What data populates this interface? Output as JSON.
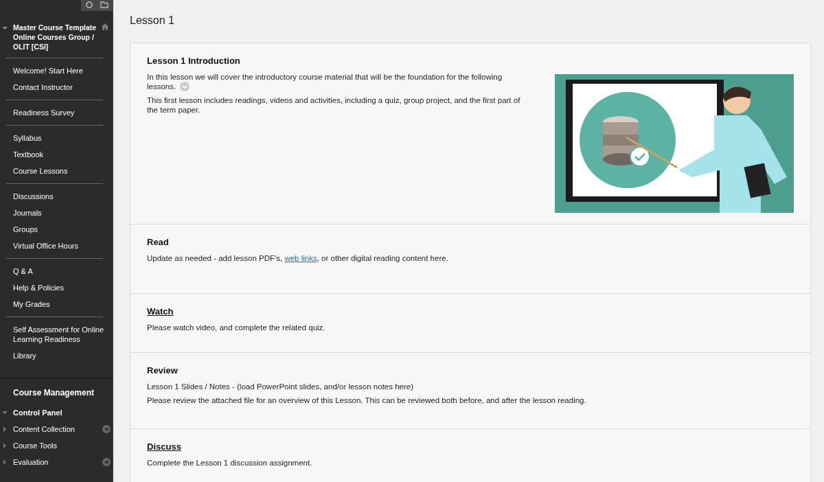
{
  "sidebar": {
    "course": {
      "title": "Master Course Template Online Courses Group / OLIT [CSI]",
      "expanded": true
    },
    "groups": [
      [
        "Welcome! Start Here",
        "Contact Instructor"
      ],
      [
        "Readiness Survey"
      ],
      [
        "Syllabus",
        "Textbook",
        "Course Lessons"
      ],
      [
        "Discussions",
        "Journals",
        "Groups",
        "Virtual Office Hours"
      ],
      [
        "Q & A",
        "Help & Policies",
        "My Grades"
      ],
      [
        "Self Assessment for Online Learning Readiness",
        "Library"
      ]
    ],
    "management": {
      "title": "Course Management",
      "panel": {
        "title": "Control Panel",
        "expanded": true
      },
      "items": [
        {
          "label": "Content Collection",
          "expanded": false,
          "has_menu": true
        },
        {
          "label": "Course Tools",
          "expanded": false,
          "has_menu": false
        },
        {
          "label": "Evaluation",
          "expanded": false,
          "has_menu": true
        }
      ]
    }
  },
  "page_title": "Lesson 1",
  "sections": [
    {
      "title": "Lesson 1 Introduction",
      "kind": "heading",
      "has_image": true,
      "paragraphs": [
        [
          {
            "text": "In this lesson we will cover the introductory course material that will be the foundation for the following lessons.",
            "link": false
          }
        ],
        [
          {
            "text": "This first lesson includes readings, videos and activities, including a quiz, group project, and the first part of the term paper.",
            "link": false
          }
        ]
      ]
    },
    {
      "title": "Read",
      "kind": "heading",
      "has_image": false,
      "paragraphs": [
        [
          {
            "text": "Update as needed - add lesson PDF's, ",
            "link": false
          },
          {
            "text": "web links",
            "link": true
          },
          {
            "text": ", or other digital reading content here.",
            "link": false
          }
        ]
      ]
    },
    {
      "title": "Watch",
      "kind": "link",
      "has_image": false,
      "paragraphs": [
        [
          {
            "text": "Please watch video, and complete the related quiz.",
            "link": false
          }
        ]
      ]
    },
    {
      "title": "Review",
      "kind": "heading",
      "has_image": false,
      "paragraphs": [
        [
          {
            "text": "Lesson 1 Slides / Notes - (load PowerPoint slides, and/or lesson notes here)",
            "link": false
          }
        ],
        [
          {
            "text": "Please review the attached file for an overview of this Lesson.  This can be reviewed both before, and after the lesson reading.",
            "link": false
          }
        ]
      ]
    },
    {
      "title": "Discuss",
      "kind": "link",
      "has_image": false,
      "paragraphs": [
        [
          {
            "text": "Complete the Lesson 1 discussion assignment.",
            "link": false
          }
        ]
      ]
    }
  ]
}
